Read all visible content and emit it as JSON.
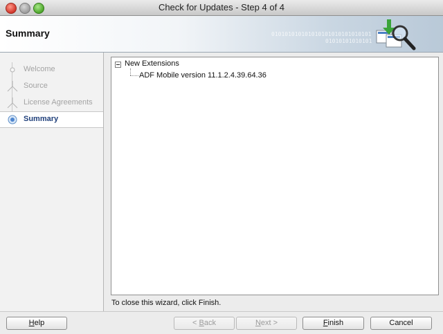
{
  "window": {
    "title": "Check for Updates - Step 4 of 4"
  },
  "header": {
    "title": "Summary",
    "decoration_line1": "010101010101010101010101010101",
    "decoration_line2": "01010101010101"
  },
  "nav": {
    "items": [
      {
        "label": "Welcome",
        "state": "completed"
      },
      {
        "label": "Source",
        "state": "completed"
      },
      {
        "label": "License Agreements",
        "state": "completed"
      },
      {
        "label": "Summary",
        "state": "current"
      }
    ]
  },
  "tree": {
    "root": "New Extensions",
    "children": [
      "ADF Mobile version 11.1.2.4.39.64.36"
    ]
  },
  "hint": "To close this wizard, click Finish.",
  "buttons": {
    "help": {
      "mnemonic": "H",
      "rest": "elp"
    },
    "back": {
      "prefix": "< ",
      "mnemonic": "B",
      "rest": "ack"
    },
    "next": {
      "mnemonic": "N",
      "rest": "ext >"
    },
    "finish": {
      "mnemonic": "F",
      "rest": "inish"
    },
    "cancel": {
      "label": "Cancel"
    }
  },
  "colors": {
    "active_step_text": "#1f3f7a",
    "inactive_step_text": "#a3a3a3"
  }
}
